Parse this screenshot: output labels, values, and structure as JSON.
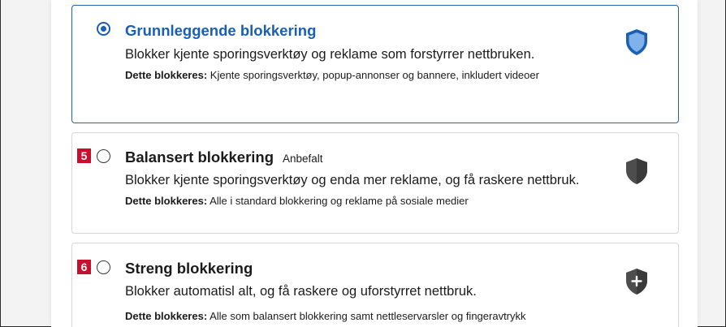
{
  "accent_color": "#1a5fb4",
  "badge_color": "#c8102e",
  "options": [
    {
      "id": "basic",
      "selected": true,
      "step_badge": "",
      "title": "Grunnleggende blokkering",
      "tag": "",
      "description": "Blokker kjente sporingsverktøy og reklame som forstyrrer nettbruken.",
      "blocked_label": "Dette blokkeres:",
      "blocked_text": "Kjente sporingsverktøy, popup-annonser og bannere, inkludert videoer",
      "icon": "shield-icon"
    },
    {
      "id": "balanced",
      "selected": false,
      "step_badge": "5",
      "title": "Balansert blokkering",
      "tag": "Anbefalt",
      "description": "Blokker kjente sporingsverktøy og enda mer reklame, og få raskere nettbruk.",
      "blocked_label": "Dette blokkeres:",
      "blocked_text": "Alle i standard blokkering og reklame på sosiale medier",
      "icon": "shield-icon"
    },
    {
      "id": "strict",
      "selected": false,
      "step_badge": "6",
      "title": "Streng blokkering",
      "tag": "",
      "description": "Blokker automatisl alt, og få raskere og uforstyrret nettbruk.",
      "blocked_label": "Dette blokkeres:",
      "blocked_text": "Alle som balansert blokkering samt nettleservarsler og fingeravtrykk",
      "icon": "shield-plus-icon"
    }
  ]
}
